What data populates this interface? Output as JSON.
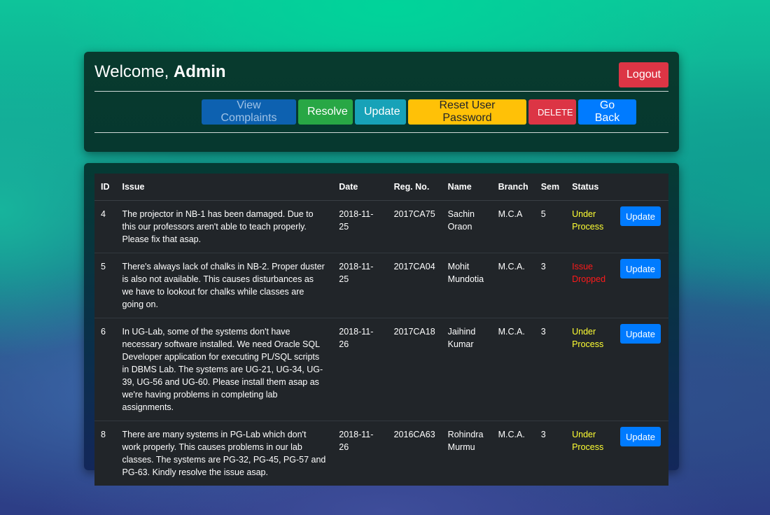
{
  "header": {
    "welcome_prefix": "Welcome, ",
    "user": "Admin",
    "logout_label": "Logout"
  },
  "nav": {
    "view": "View Complaints",
    "resolve": "Resolve",
    "update": "Update",
    "reset": "Reset User Password",
    "delete": "DELETE",
    "back": "Go Back"
  },
  "table": {
    "columns": [
      "ID",
      "Issue",
      "Date",
      "Reg. No.",
      "Name",
      "Branch",
      "Sem",
      "Status"
    ],
    "update_label": "Update",
    "rows": [
      {
        "id": "4",
        "issue": "The projector in NB-1 has been damaged. Due to this our professors aren't able to teach properly. Please fix that asap.",
        "date": "2018-11-25",
        "reg": "2017CA75",
        "name": "Sachin Oraon",
        "branch": "M.C.A",
        "sem": "5",
        "status": "Under Process"
      },
      {
        "id": "5",
        "issue": "There's always lack of chalks in NB-2. Proper duster is also not available. This causes disturbances as we have to lookout for chalks while classes are going on.",
        "date": "2018-11-25",
        "reg": "2017CA04",
        "name": "Mohit Mundotia",
        "branch": "M.C.A.",
        "sem": "3",
        "status": "Issue Dropped"
      },
      {
        "id": "6",
        "issue": "In UG-Lab, some of the systems don't have necessary software installed. We need Oracle SQL Developer application for executing PL/SQL scripts in DBMS Lab. The systems are UG-21, UG-34, UG-39, UG-56 and UG-60. Please install them asap as we're having problems in completing lab assignments.",
        "date": "2018-11-26",
        "reg": "2017CA18",
        "name": "Jaihind Kumar",
        "branch": "M.C.A.",
        "sem": "3",
        "status": "Under Process"
      },
      {
        "id": "8",
        "issue": "There are many systems in PG-Lab which don't work properly. This causes problems in our lab classes. The systems are PG-32, PG-45, PG-57 and PG-63. Kindly resolve the issue asap.",
        "date": "2018-11-26",
        "reg": "2016CA63",
        "name": "Rohindra Murmu",
        "branch": "M.C.A.",
        "sem": "3",
        "status": "Under Process"
      }
    ]
  },
  "colors": {
    "under_process": "#ffff33",
    "issue_dropped": "#ff1a1a"
  }
}
